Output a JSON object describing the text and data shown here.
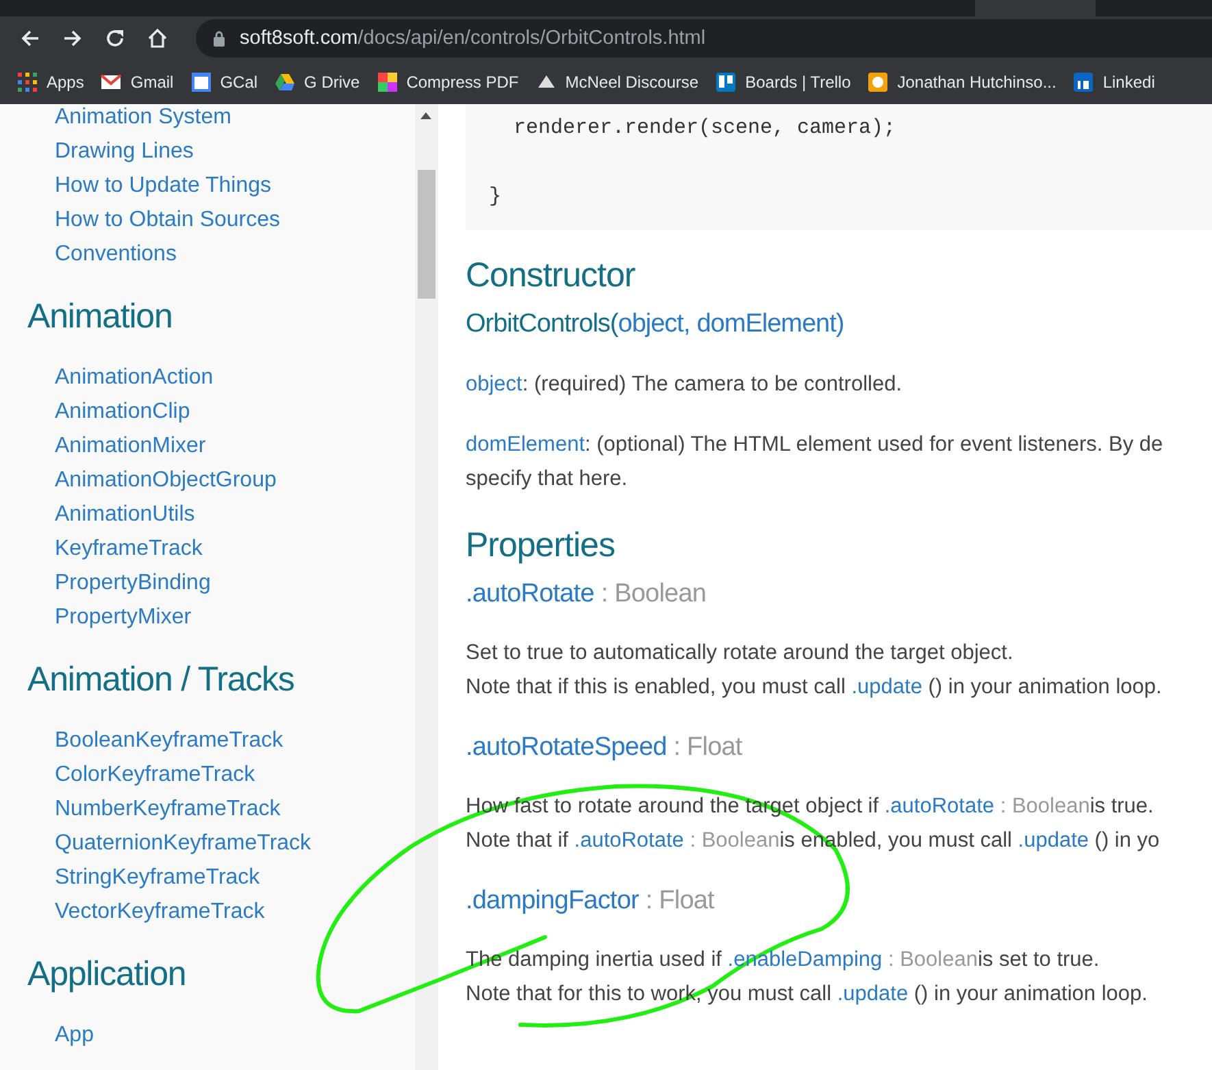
{
  "browser": {
    "url_host": "soft8soft.com",
    "url_path": "/docs/api/en/controls/OrbitControls.html",
    "bookmarks": [
      {
        "label": "Apps"
      },
      {
        "label": "Gmail"
      },
      {
        "label": "GCal"
      },
      {
        "label": "G Drive"
      },
      {
        "label": "Compress PDF"
      },
      {
        "label": "McNeel Discourse"
      },
      {
        "label": "Boards | Trello"
      },
      {
        "label": "Jonathan Hutchinso..."
      },
      {
        "label": "Linkedi"
      }
    ]
  },
  "sidebar": {
    "sections": [
      {
        "items": [
          "Animation System",
          "Drawing Lines",
          "How to Update Things",
          "How to Obtain Sources",
          "Conventions"
        ]
      },
      {
        "heading": "Animation",
        "items": [
          "AnimationAction",
          "AnimationClip",
          "AnimationMixer",
          "AnimationObjectGroup",
          "AnimationUtils",
          "KeyframeTrack",
          "PropertyBinding",
          "PropertyMixer"
        ]
      },
      {
        "heading": "Animation / Tracks",
        "items": [
          "BooleanKeyframeTrack",
          "ColorKeyframeTrack",
          "NumberKeyframeTrack",
          "QuaternionKeyframeTrack",
          "StringKeyframeTrack",
          "VectorKeyframeTrack"
        ]
      },
      {
        "heading": "Application",
        "items": [
          "App"
        ]
      }
    ]
  },
  "content": [
    {
      "kind": "code",
      "lines": [
        "  renderer.render(scene, camera);",
        "}"
      ]
    },
    {
      "kind": "heading",
      "text": "Constructor"
    },
    {
      "kind": "signature",
      "parts": [
        {
          "kind": "text",
          "text": "OrbitControls("
        },
        {
          "kind": "link",
          "text": "object,"
        },
        {
          "kind": "link",
          "text": "domElement)"
        }
      ]
    },
    {
      "kind": "para",
      "lines": [
        [
          {
            "kind": "link",
            "text": "object"
          },
          {
            "kind": "text",
            "text": ": (required) The camera to be controlled."
          }
        ]
      ]
    },
    {
      "kind": "para",
      "lines": [
        [
          {
            "kind": "link",
            "text": "domElement"
          },
          {
            "kind": "text",
            "text": ": (optional) The HTML element used for event listeners. By de"
          }
        ],
        [
          {
            "kind": "text",
            "text": "specify that here."
          }
        ]
      ]
    },
    {
      "kind": "heading",
      "text": "Properties"
    },
    {
      "kind": "property",
      "name": ".autoRotate",
      "type": ": Boolean"
    },
    {
      "kind": "para",
      "lines": [
        [
          {
            "kind": "text",
            "text": "Set to true to automatically rotate around the target object."
          }
        ],
        [
          {
            "kind": "text",
            "text": "Note that if this is enabled, you must call "
          },
          {
            "kind": "link",
            "text": ".update"
          },
          {
            "kind": "text",
            "text": " () in your animation loop."
          }
        ]
      ]
    },
    {
      "kind": "property",
      "name": ".autoRotateSpeed",
      "type": ": Float"
    },
    {
      "kind": "para",
      "lines": [
        [
          {
            "kind": "text",
            "text": "How fast to rotate around the target object if "
          },
          {
            "kind": "link",
            "text": ".autoRotate"
          },
          {
            "kind": "type",
            "text": " : Boolean"
          },
          {
            "kind": "text",
            "text": "is true."
          }
        ],
        [
          {
            "kind": "text",
            "text": "Note that if "
          },
          {
            "kind": "link",
            "text": ".autoRotate"
          },
          {
            "kind": "type",
            "text": " : Boolean"
          },
          {
            "kind": "text",
            "text": "is enabled, you must call "
          },
          {
            "kind": "link",
            "text": ".update"
          },
          {
            "kind": "text",
            "text": " () in yo"
          }
        ]
      ]
    },
    {
      "kind": "property",
      "name": ".dampingFactor",
      "type": ": Float"
    },
    {
      "kind": "para",
      "lines": [
        [
          {
            "kind": "text",
            "text": "The damping inertia used if "
          },
          {
            "kind": "link",
            "text": ".enableDamping"
          },
          {
            "kind": "type",
            "text": " : Boolean"
          },
          {
            "kind": "text",
            "text": "is set to true."
          }
        ],
        [
          {
            "kind": "text",
            "text": "Note that for this to work, you must call "
          },
          {
            "kind": "link",
            "text": ".update"
          },
          {
            "kind": "text",
            "text": " () in your animation loop."
          }
        ]
      ]
    }
  ]
}
